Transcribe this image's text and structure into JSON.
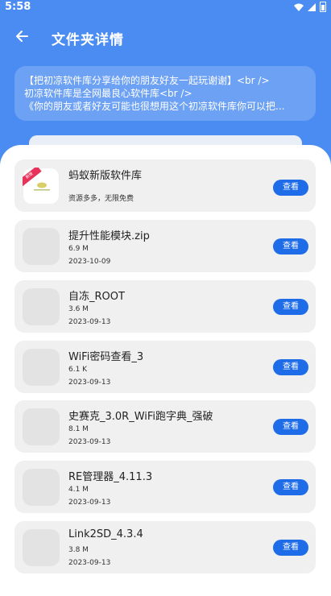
{
  "status_bar": {
    "time": "5:58"
  },
  "toolbar": {
    "title": "文件夹详情"
  },
  "share": {
    "line1": "【把初凉软件库分享给你的朋友好友一起玩谢谢】<br />",
    "line2": "初凉软件库是全网最良心软件库<br />",
    "line3": "《你的朋友或者好友可能也很想用这个初凉软件库你可以把..."
  },
  "view_label": "查看",
  "featured": {
    "name": "蚂蚁新版软件库",
    "desc": "资源多多，无限免费",
    "ribbon": "新版"
  },
  "files": [
    {
      "name": "提升性能模块.zip",
      "size": "6.9 M",
      "date": "2023-10-09"
    },
    {
      "name": "自冻_ROOT",
      "size": "3.6 M",
      "date": "2023-09-13"
    },
    {
      "name": "WiFi密码查看_3",
      "size": "6.1 K",
      "date": "2023-09-13"
    },
    {
      "name": "史赛克_3.0R_WiFi跑字典_强破",
      "size": "8.1 M",
      "date": "2023-09-13"
    },
    {
      "name": "RE管理器_4.11.3",
      "size": "4.1 M",
      "date": "2023-09-13"
    },
    {
      "name": "Link2SD_4.3.4",
      "size": "3.8 M",
      "date": "2023-09-13"
    }
  ],
  "colors": {
    "header": "#4a8cf2",
    "button": "#1f6ce8",
    "card": "#f0f0f0"
  }
}
